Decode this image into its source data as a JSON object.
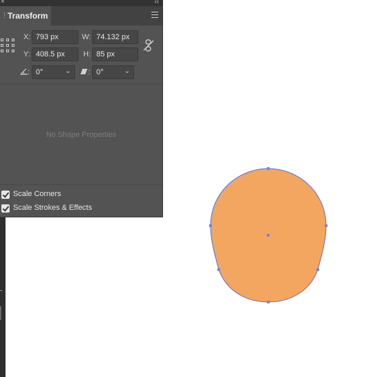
{
  "panel": {
    "title": "Transform",
    "close_glyph": "×",
    "collapse_glyph": "‹‹",
    "icons": [
      "close-icon",
      "collapse-icon",
      "panel-menu-icon",
      "reference-point-icon",
      "link-proportions-icon",
      "angle-icon",
      "shear-icon",
      "checkbox-icon"
    ],
    "x_label": "X:",
    "x_value": "793 px",
    "y_label": "Y:",
    "y_value": "408.5 px",
    "w_label": "W:",
    "w_value": "74.132 px",
    "h_label": "H:",
    "h_value": "85 px",
    "angle_label": ":",
    "angle_value": "0°",
    "shear_label": ":",
    "shear_value": "0°",
    "dropdown_glyph": "⌄",
    "empty_message": "No Shape Properties",
    "options": [
      {
        "label": "Scale Corners",
        "checked": true
      },
      {
        "label": "Scale Strokes & Effects",
        "checked": true
      }
    ]
  },
  "canvas": {
    "shape_fill": "#F2A65F",
    "shape_stroke": "#5B6BD6",
    "handle_color": "#6F86E8"
  }
}
